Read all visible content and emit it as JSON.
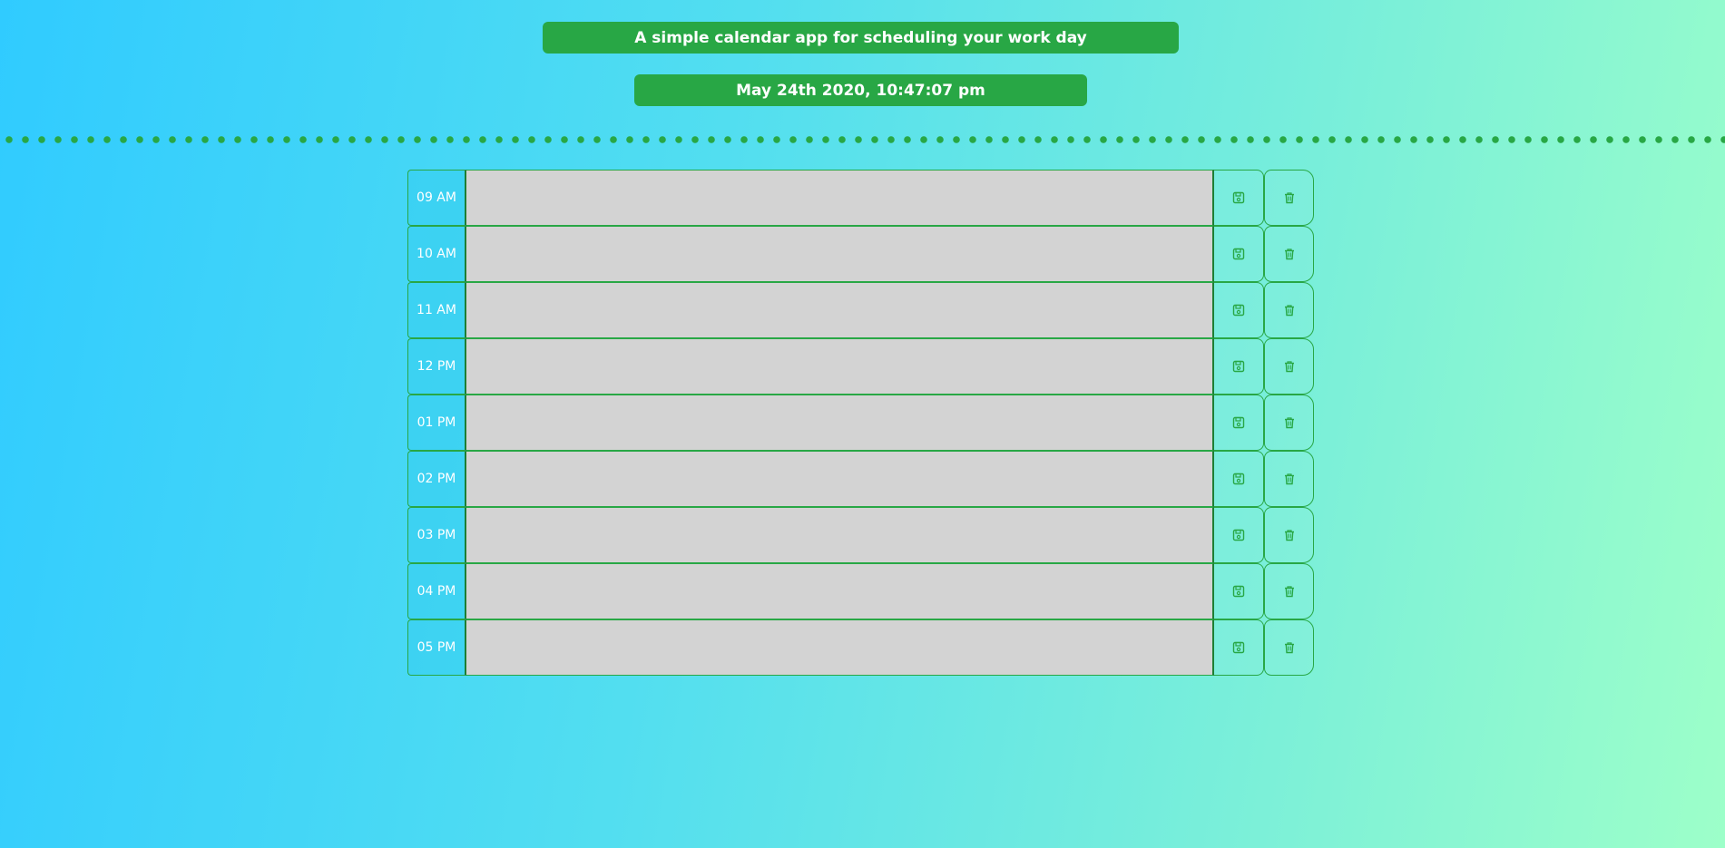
{
  "header": {
    "subtitle": "A simple calendar app for scheduling your work day",
    "datetime": "May 24th 2020, 10:47:07 pm"
  },
  "schedule": {
    "rows": [
      {
        "hour": "09 AM",
        "note": ""
      },
      {
        "hour": "10 AM",
        "note": ""
      },
      {
        "hour": "11 AM",
        "note": ""
      },
      {
        "hour": "12 PM",
        "note": ""
      },
      {
        "hour": "01 PM",
        "note": ""
      },
      {
        "hour": "02 PM",
        "note": ""
      },
      {
        "hour": "03 PM",
        "note": ""
      },
      {
        "hour": "04 PM",
        "note": ""
      },
      {
        "hour": "05 PM",
        "note": ""
      }
    ],
    "save_icon": "floppy-disk-icon",
    "delete_icon": "trash-icon"
  },
  "colors": {
    "accent": "#28a745",
    "row_background": "#d3d3d3",
    "gradient_start": "#30cbff",
    "gradient_end": "#9dffc9"
  }
}
